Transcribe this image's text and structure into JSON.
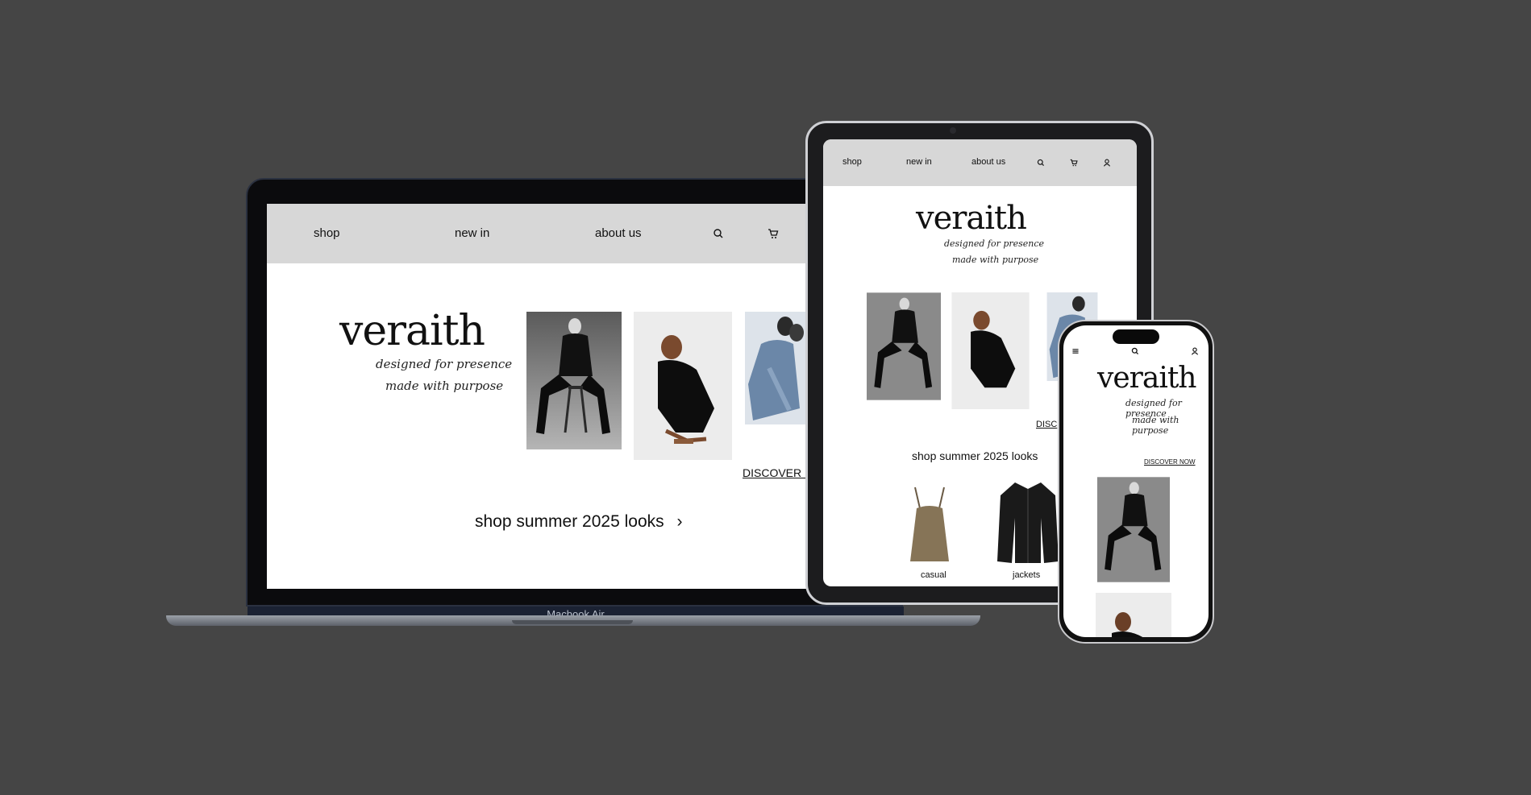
{
  "brand": {
    "logo": "veraith",
    "tagline_1": "designed for presence",
    "tagline_2": "made with purpose"
  },
  "nav": {
    "shop": "shop",
    "new_in": "new in",
    "about_us": "about us",
    "icons": [
      "search-icon",
      "cart-icon",
      "user-icon",
      "menu-icon"
    ]
  },
  "hero": {
    "discover_laptop": "DISCOVER N",
    "discover_tablet": "DISC",
    "discover_phone": "DISCOVER NOW",
    "cta": "shop summer 2025 looks",
    "cta_arrow": "›"
  },
  "categories": [
    {
      "label": "casual",
      "icon": "camisole-image"
    },
    {
      "label": "jackets",
      "icon": "leather-jacket-image"
    }
  ],
  "devices": {
    "laptop_label": "Macbook Air"
  },
  "colors": {
    "background": "#454545",
    "nav_bg": "#d7d7d7",
    "screen_bg": "#ffffff",
    "text": "#111111"
  }
}
